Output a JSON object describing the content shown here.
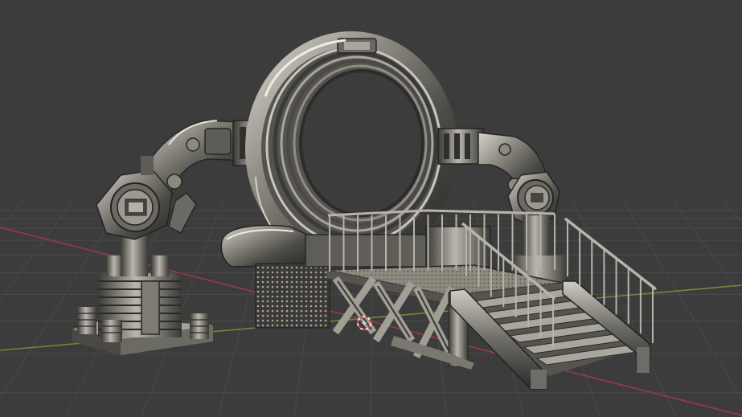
{
  "viewport": {
    "name": "3d-viewport",
    "background": "#3c3c3c",
    "grid_color": "#4a4a4a",
    "x_axis_color": "#9a3a48",
    "y_axis_color": "#6f8a35"
  },
  "model": {
    "name": "sci-fi-portal-gate",
    "metal_dark": "#1e1e1c",
    "metal_mid": "#5b5a55",
    "metal_light": "#bab7ae",
    "metal_highlight": "#e6e3da"
  },
  "origin_marker": {
    "icon": "object-origin-icon",
    "color_red": "#e0413a",
    "color_white": "#f2f2f2"
  }
}
